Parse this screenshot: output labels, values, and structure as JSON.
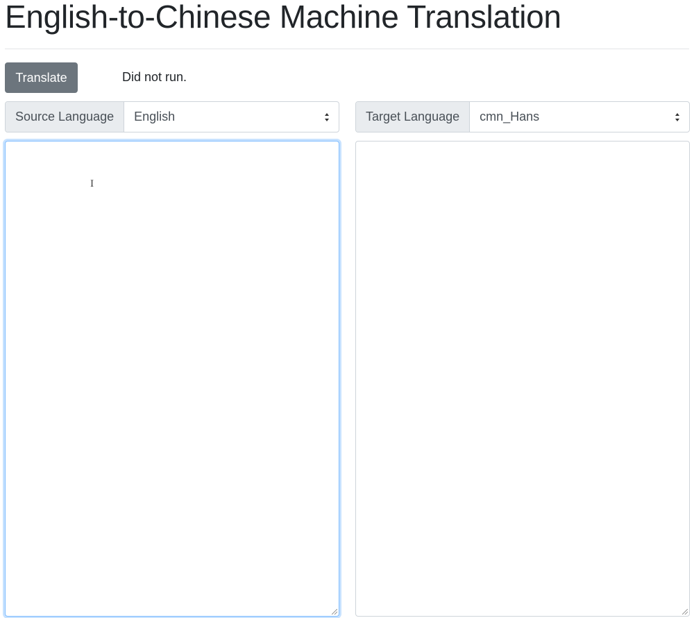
{
  "header": {
    "title": "English-to-Chinese Machine Translation"
  },
  "toolbar": {
    "translate_label": "Translate",
    "status_text": "Did not run."
  },
  "source": {
    "label": "Source Language",
    "selected": "English",
    "text": ""
  },
  "target": {
    "label": "Target Language",
    "selected": "cmn_Hans",
    "text": ""
  },
  "colors": {
    "button_bg": "#6c757d",
    "focus_border": "#80bdff",
    "addon_bg": "#e9ecef"
  },
  "icons": {
    "select_caret": "chevron-up-down-icon",
    "text_cursor": "i-beam-cursor-icon"
  }
}
